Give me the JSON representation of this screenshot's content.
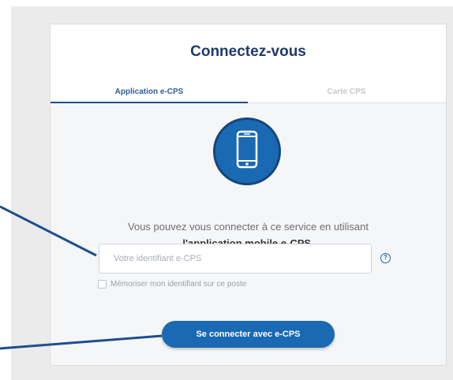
{
  "login": {
    "title": "Connectez-vous",
    "tabs": [
      {
        "label": "Application e-CPS",
        "active": true
      },
      {
        "label": "Carte CPS",
        "active": false
      }
    ],
    "icon": "smartphone-icon",
    "description": "Vous pouvez vous connecter à ce service en utilisant",
    "description_strong": "l'application mobile e-CPS.",
    "id_field": {
      "placeholder": "Votre identifiant e-CPS",
      "value": ""
    },
    "help_symbol": "?",
    "remember_label": "Mémoriser mon identifiant sur ce poste",
    "remember_checked": false,
    "connect_label": "Se connecter avec e-CPS"
  },
  "colors": {
    "title": "#1e3a6e",
    "accent": "#1a69b3",
    "annotation_line": "#1e4f8c"
  }
}
